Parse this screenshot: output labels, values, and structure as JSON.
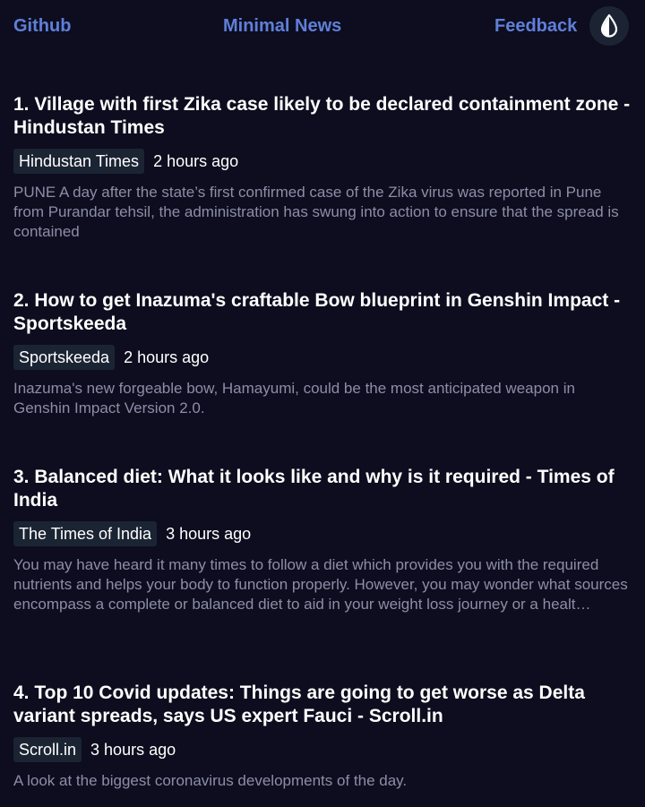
{
  "nav": {
    "github": "Github",
    "title": "Minimal News",
    "feedback": "Feedback",
    "theme_icon": "water-drop-half-icon"
  },
  "articles": [
    {
      "title": "1. Village with first Zika case likely to be declared containment zone - Hindustan Times",
      "source": "Hindustan Times",
      "time": "2 hours ago",
      "description": "PUNE A day after the state’s first confirmed case of the Zika virus was reported in Pune from Purandar tehsil, the administration has swung into action to ensure that the spread is contained"
    },
    {
      "title": "2. How to get Inazuma's craftable Bow blueprint in Genshin Impact - Sportskeeda",
      "source": "Sportskeeda",
      "time": "2 hours ago",
      "description": "Inazuma's new forgeable bow, Hamayumi, could be the most anticipated weapon in Genshin Impact Version 2.0."
    },
    {
      "title": "3. Balanced diet: What it looks like and why is it required - Times of India",
      "source": "The Times of India",
      "time": "3 hours ago",
      "description": "You may have heard it many times to follow a diet which provides you with the required nutrients and helps your body to function properly. However, you may wonder what sources encompass a complete or balanced diet to aid in your weight loss journey or a healt…"
    },
    {
      "title": "4. Top 10 Covid updates: Things are going to get worse as Delta variant spreads, says US expert Fauci - Scroll.in",
      "source": "Scroll.in",
      "time": "3 hours ago",
      "description": "A look at the biggest coronavirus developments of the day."
    }
  ]
}
